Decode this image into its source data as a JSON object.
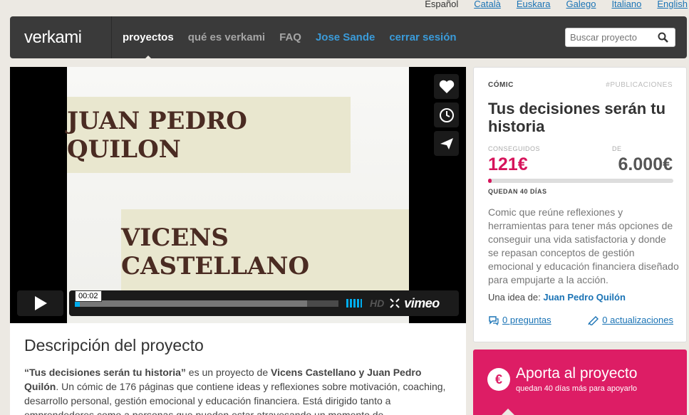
{
  "languages": [
    {
      "label": "Español",
      "current": true
    },
    {
      "label": "Català",
      "current": false
    },
    {
      "label": "Euskara",
      "current": false
    },
    {
      "label": "Galego",
      "current": false
    },
    {
      "label": "Italiano",
      "current": false
    },
    {
      "label": "English",
      "current": false
    }
  ],
  "nav": {
    "logo": "verkami",
    "items": [
      "proyectos",
      "qué es verkami",
      "FAQ"
    ],
    "user": "Jose Sande",
    "logout": "cerrar sesión",
    "search_placeholder": "Buscar proyecto"
  },
  "video": {
    "card1": "JUAN PEDRO QUILON",
    "card2": "VICENS CASTELLANO",
    "time": "00:02",
    "progress": 0.02,
    "loaded": 0.88,
    "hd": "HD",
    "brand": "vimeo"
  },
  "description": {
    "heading": "Descripción del proyecto",
    "quote": "“Tus decisiones serán tu historia”",
    "text_1": " es un proyecto de ",
    "authors": "Vicens Castellano y Juan Pedro Quilón",
    "text_2": ". Un cómic de 176 páginas que contiene ideas y reflexiones sobre motivación, coaching, desarrollo personal, gestión emocional y educación financiera. Está dirigido tanto a emprendedores como a personas que pueden estar atravesando un momento de"
  },
  "project": {
    "category": "CÓMIC",
    "tag": "#PUBLICACIONES",
    "title": "Tus decisiones serán tu historia",
    "raised_label": "CONSEGUIDOS",
    "raised": "121€",
    "goal_label": "DE",
    "goal": "6.000€",
    "progress": 0.02,
    "days_left": "QUEDAN 40 DÍAS",
    "summary": "Comic que reúne reflexiones y herramientas para tener más opciones de conseguir una vida satisfactoria y donde se repasan conceptos de gestión emocional y educación financiera diseñado para empujarte a la acción.",
    "idea_label": "Una idea de:",
    "author": "Juan Pedro Quilón",
    "questions": "0 preguntas",
    "updates": "0 actualizaciones"
  },
  "fund": {
    "title": "Aporta al proyecto",
    "subtitle": "quedan 40 días más para apoyarlo",
    "icon": "€"
  },
  "colors": {
    "accent": "#dd1d65",
    "link": "#1a73b5",
    "nav_bg": "#3a3a3a",
    "vimeo_blue": "#00adef"
  }
}
